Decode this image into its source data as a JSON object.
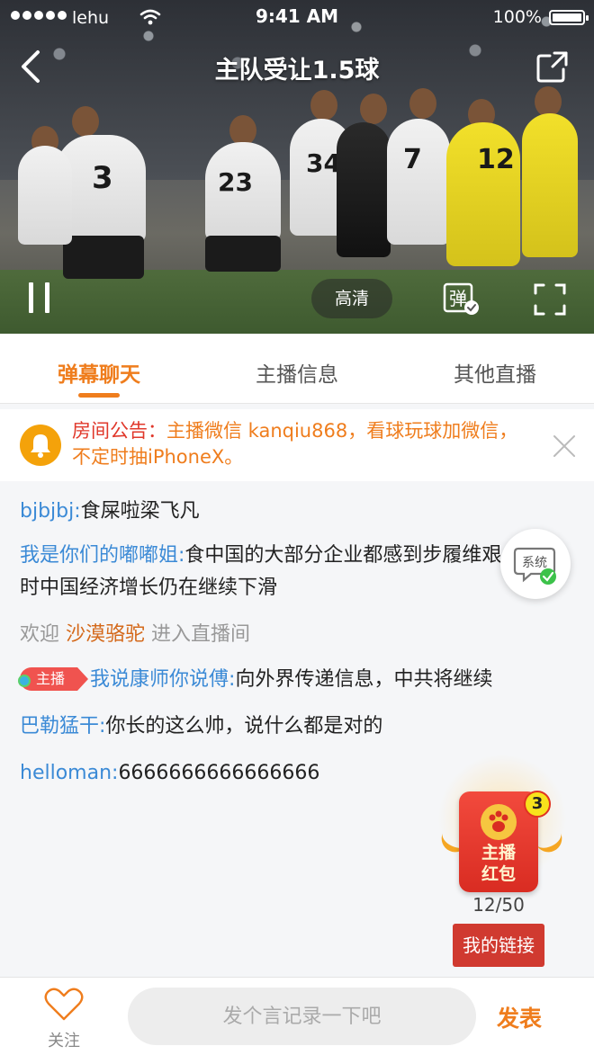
{
  "status_bar": {
    "carrier": "lehu",
    "time": "9:41 AM",
    "battery": "100%"
  },
  "nav": {
    "title": "主队受让1.5球"
  },
  "player_controls": {
    "quality": "高清",
    "danmu_toggle": "弹"
  },
  "tabs": [
    {
      "label": "弹幕聊天",
      "active": true
    },
    {
      "label": "主播信息",
      "active": false
    },
    {
      "label": "其他直播",
      "active": false
    }
  ],
  "notice": {
    "label": "房间公告：",
    "text": "主播微信 kanqiu868，看球玩球加微信，不定时抽iPhoneX。"
  },
  "chat": {
    "messages": [
      {
        "nick": "bjbjbj:",
        "text": "食屎啦梁飞凡"
      },
      {
        "nick": "我是你们的嘟嘟姐:",
        "text": "食中国的大部分企业都感到步履维艰。此时中国经济增长仍在继续下滑"
      }
    ],
    "welcome": {
      "prefix": "欢迎",
      "user": "沙漠骆驼",
      "suffix": "进入直播间"
    },
    "host_message": {
      "tag": "主播",
      "nick": "我说康师你说傅:",
      "text": "向外界传递信息，中共将继续"
    },
    "more_messages": [
      {
        "nick": "巴勒猛干:",
        "text": "你长的这么帅，说什么都是对的"
      },
      {
        "nick": "helloman:",
        "text": "6666666666666666"
      }
    ]
  },
  "system_button": {
    "label": "系统"
  },
  "red_packet": {
    "label_line1": "主播",
    "label_line2": "红包",
    "badge": "3",
    "count": "12/50"
  },
  "my_link": {
    "label": "我的链接"
  },
  "bottom_bar": {
    "follow_label": "关注",
    "input_placeholder": "发个言记录一下吧",
    "send_label": "发表"
  },
  "colors": {
    "accent": "#ef7d1d",
    "nick_blue": "#3b8ad6",
    "notice_red": "#e0382b",
    "link_button": "#d03a30"
  }
}
